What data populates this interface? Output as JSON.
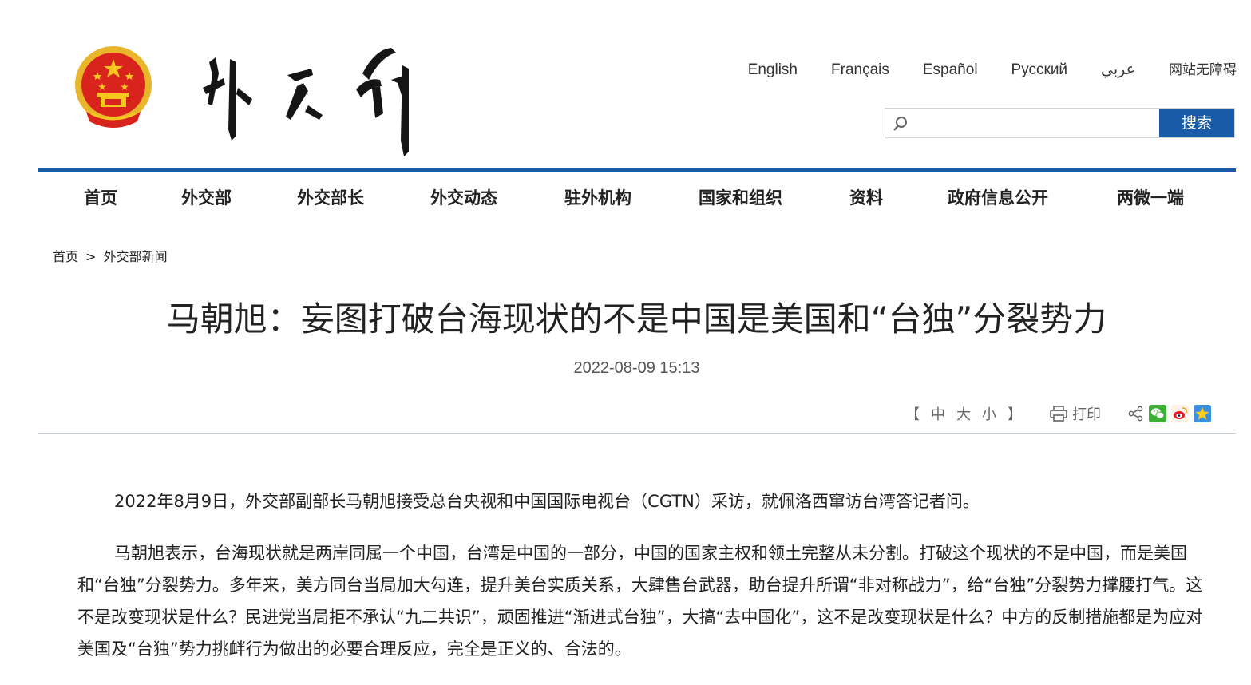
{
  "header": {
    "languages": [
      "English",
      "Français",
      "Español",
      "Русский",
      "عربي",
      "网站无障碍"
    ],
    "search": {
      "placeholder": "",
      "button_label": "搜索"
    }
  },
  "nav": {
    "items": [
      "首页",
      "外交部",
      "外交部长",
      "外交动态",
      "驻外机构",
      "国家和组织",
      "资料",
      "政府信息公开",
      "两微一端"
    ]
  },
  "breadcrumb": {
    "home": "首页",
    "separator": ">",
    "section": "外交部新闻"
  },
  "article": {
    "title": "马朝旭：妄图打破台海现状的不是中国是美国和“台独”分裂势力",
    "date": "2022-08-09 15:13",
    "toolbar": {
      "bracket_open": "【",
      "size_mid": "中",
      "size_large": "大",
      "size_small": "小",
      "bracket_close": "】",
      "print_label": "打印"
    },
    "paragraphs": [
      "2022年8月9日，外交部副部长马朝旭接受总台央视和中国国际电视台（CGTN）采访，就佩洛西窜访台湾答记者问。",
      "马朝旭表示，台海现状就是两岸同属一个中国，台湾是中国的一部分，中国的国家主权和领土完整从未分割。打破这个现状的不是中国，而是美国和“台独”分裂势力。多年来，美方同台当局加大勾连，提升美台实质关系，大肆售台武器，助台提升所谓“非对称战力”，给“台独”分裂势力撑腰打气。这不是改变现状是什么？民进党当局拒不承认“九二共识”，顽固推进“渐进式台独”，大搞“去中国化”，这不是改变现状是什么？中方的反制措施都是为应对美国及“台独”势力挑衅行为做出的必要合理反应，完全是正义的、合法的。"
    ]
  },
  "colors": {
    "brand_blue": "#1a5ba8",
    "emblem_red": "#d8241c",
    "emblem_gold": "#f2b81f"
  }
}
